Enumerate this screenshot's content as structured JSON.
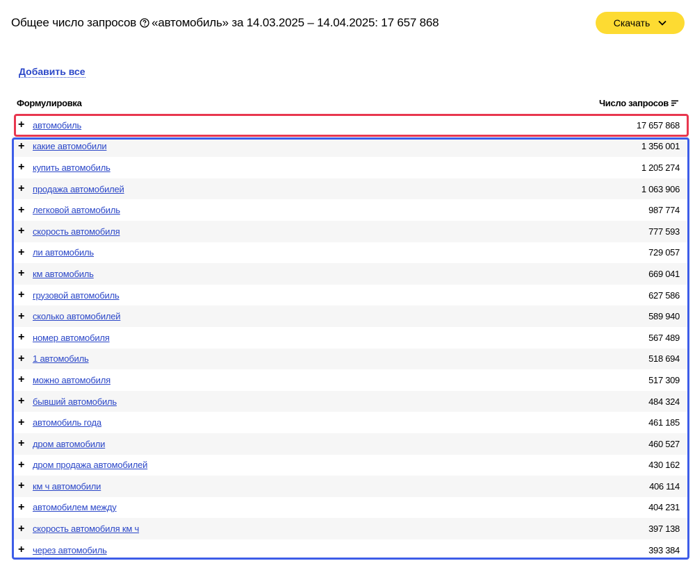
{
  "header": {
    "prefix": "Общее число запросов",
    "suffix": "«автомобиль» за 14.03.2025 – 14.04.2025: 17 657 868"
  },
  "download_label": "Скачать",
  "add_all_label": "Добавить все",
  "columns": {
    "phrase": "Формулировка",
    "count": "Число запросов"
  },
  "rows": [
    {
      "phrase": "автомобиль",
      "count": "17 657 868"
    },
    {
      "phrase": "какие автомобили",
      "count": "1 356 001"
    },
    {
      "phrase": "купить автомобиль",
      "count": "1 205 274"
    },
    {
      "phrase": "продажа автомобилей",
      "count": "1 063 906"
    },
    {
      "phrase": "легковой автомобиль",
      "count": "987 774"
    },
    {
      "phrase": "скорость автомобиля",
      "count": "777 593"
    },
    {
      "phrase": "ли автомобиль",
      "count": "729 057"
    },
    {
      "phrase": "км автомобиль",
      "count": "669 041"
    },
    {
      "phrase": "грузовой автомобиль",
      "count": "627 586"
    },
    {
      "phrase": "сколько автомобилей",
      "count": "589 940"
    },
    {
      "phrase": "номер автомобиля",
      "count": "567 489"
    },
    {
      "phrase": "1 автомобиль",
      "count": "518 694"
    },
    {
      "phrase": "можно автомобиля",
      "count": "517 309"
    },
    {
      "phrase": "бывший автомобиль",
      "count": "484 324"
    },
    {
      "phrase": "автомобиль года",
      "count": "461 185"
    },
    {
      "phrase": "дром автомобили",
      "count": "460 527"
    },
    {
      "phrase": "дром продажа автомобилей",
      "count": "430 162"
    },
    {
      "phrase": "км ч автомобили",
      "count": "406 114"
    },
    {
      "phrase": "автомобилем между",
      "count": "404 231"
    },
    {
      "phrase": "скорость автомобиля км ч",
      "count": "397 138"
    },
    {
      "phrase": "через автомобиль",
      "count": "393 384"
    }
  ],
  "colors": {
    "accent_button": "#fddb32",
    "link": "#2b47c8",
    "highlight_red": "#e8374f",
    "highlight_blue": "#3d5de8"
  },
  "icons": [
    "help-icon",
    "chevron-down-icon",
    "sort-icon",
    "plus-icon"
  ]
}
